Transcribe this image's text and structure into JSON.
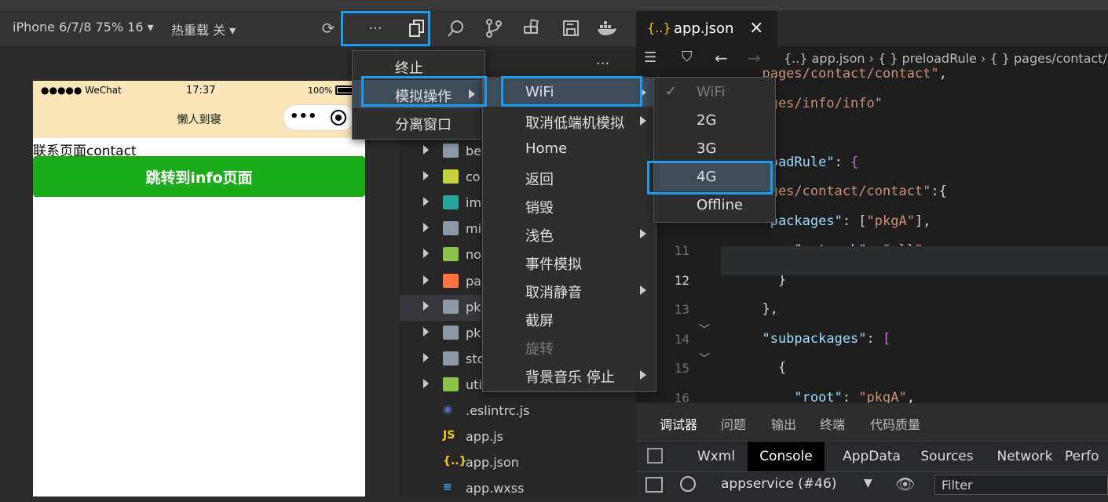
{
  "simulator_toolbar": {
    "device_label": "iPhone 6/7/8 75% 16",
    "hot_reload_label": "热重载 关"
  },
  "phone": {
    "status_carrier": "●●●●● WeChat",
    "status_time": "17:37",
    "status_battery": "100%",
    "nav_title": "懒人到寝",
    "capsule_more": "•••",
    "page_text": "联系页面contact",
    "button_label": "跳转到info页面"
  },
  "file_tree": {
    "items": [
      {
        "name": "be",
        "type": "folder",
        "color": "#8b9aa6",
        "expandable": true
      },
      {
        "name": "co",
        "type": "folder",
        "color": "#c5d23a",
        "expandable": true
      },
      {
        "name": "im",
        "type": "folder",
        "color": "#26a69a",
        "expandable": true
      },
      {
        "name": "mi",
        "type": "folder",
        "color": "#8b9aa6",
        "expandable": true
      },
      {
        "name": "no",
        "type": "folder",
        "color": "#8bc34a",
        "expandable": true
      },
      {
        "name": "pa",
        "type": "folder",
        "color": "#ff7043",
        "expandable": true
      },
      {
        "name": "pk",
        "type": "folder",
        "color": "#8b9aa6",
        "expandable": true
      },
      {
        "name": "pk",
        "type": "folder",
        "color": "#8b9aa6",
        "expandable": true
      },
      {
        "name": "sto",
        "type": "folder",
        "color": "#8b9aa6",
        "expandable": true
      },
      {
        "name": "uti",
        "type": "folder",
        "color": "#8bc34a",
        "expandable": true
      },
      {
        "name": ".eslintrc.js",
        "type": "file",
        "color": "#5c6bc0",
        "expandable": false
      },
      {
        "name": "app.js",
        "type": "file",
        "color": "#f5c518",
        "expandable": false
      },
      {
        "name": "app.json",
        "type": "file",
        "color": "#f5c518",
        "expandable": false
      },
      {
        "name": "app.wxss",
        "type": "file",
        "color": "#42a5f5",
        "expandable": false
      }
    ]
  },
  "editor": {
    "tab_icon": "{..}",
    "tab_label": "app.json",
    "tab_close": "×",
    "breadcrumb": [
      "{..} app.json",
      "{ } preloadRule",
      "{ } pages/contact/c"
    ],
    "lines": [
      {
        "n": "",
        "parts": [
          [
            "str",
            "  pages/contact/contact\""
          ],
          [
            "pun",
            ","
          ]
        ]
      },
      {
        "n": "",
        "parts": [
          [
            "str",
            "  ages/info/info\""
          ]
        ]
      },
      {
        "n": "",
        "parts": [
          [
            "pun",
            ""
          ]
        ]
      },
      {
        "n": "",
        "parts": [
          [
            "key",
            "  loadRule\""
          ],
          [
            "pun",
            ": "
          ],
          [
            "brk",
            "{"
          ]
        ]
      },
      {
        "n": "",
        "parts": [
          [
            "str",
            "  ages/contact/contact\""
          ],
          [
            "pun",
            ":{"
          ]
        ]
      },
      {
        "n": "",
        "parts": [
          [
            "key",
            "  \"packages\""
          ],
          [
            "pun",
            ": ["
          ],
          [
            "str",
            "\"pkgA\""
          ],
          [
            "pun",
            "],"
          ]
        ]
      },
      {
        "n": "11",
        "parts": [
          [
            "key",
            "      \"network\""
          ],
          [
            "pun",
            ": "
          ],
          [
            "str",
            "\"all\""
          ]
        ]
      },
      {
        "n": "12",
        "parts": [
          [
            "pun",
            "    }"
          ]
        ]
      },
      {
        "n": "13",
        "parts": [
          [
            "pun",
            "  },"
          ]
        ]
      },
      {
        "n": "14",
        "parts": [
          [
            "key",
            "  \"subpackages\""
          ],
          [
            "pun",
            ": "
          ],
          [
            "brk",
            "["
          ]
        ]
      },
      {
        "n": "15",
        "parts": [
          [
            "pun",
            "    {"
          ]
        ]
      },
      {
        "n": "16",
        "parts": [
          [
            "key",
            "      \"root\""
          ],
          [
            "pun",
            ": "
          ],
          [
            "str",
            "\"pkgA\""
          ],
          [
            "pun",
            ","
          ]
        ]
      }
    ]
  },
  "devtools": {
    "tabs_primary": [
      "调试器",
      "问题",
      "输出",
      "终端",
      "代码质量"
    ],
    "tabs_secondary": [
      "Wxml",
      "Console",
      "AppData",
      "Sources",
      "Network",
      "Perfo"
    ],
    "context_select": "appservice (#46)",
    "filter_placeholder": "Filter"
  },
  "menus": {
    "more_menu": [
      "终止",
      "模拟操作",
      "分离窗口"
    ],
    "simulate_menu": [
      "WiFi",
      "取消低端机模拟",
      "Home",
      "返回",
      "销毁",
      "浅色",
      "事件模拟",
      "取消静音",
      "截屏",
      "旋转",
      "背景音乐 停止"
    ],
    "network_menu": [
      "WiFi",
      "2G",
      "3G",
      "4G",
      "Offline"
    ]
  },
  "colors": {
    "highlight": "#1a9cf0",
    "phone_button": "#1aad19",
    "nav_bg": "#f9e5b8"
  }
}
